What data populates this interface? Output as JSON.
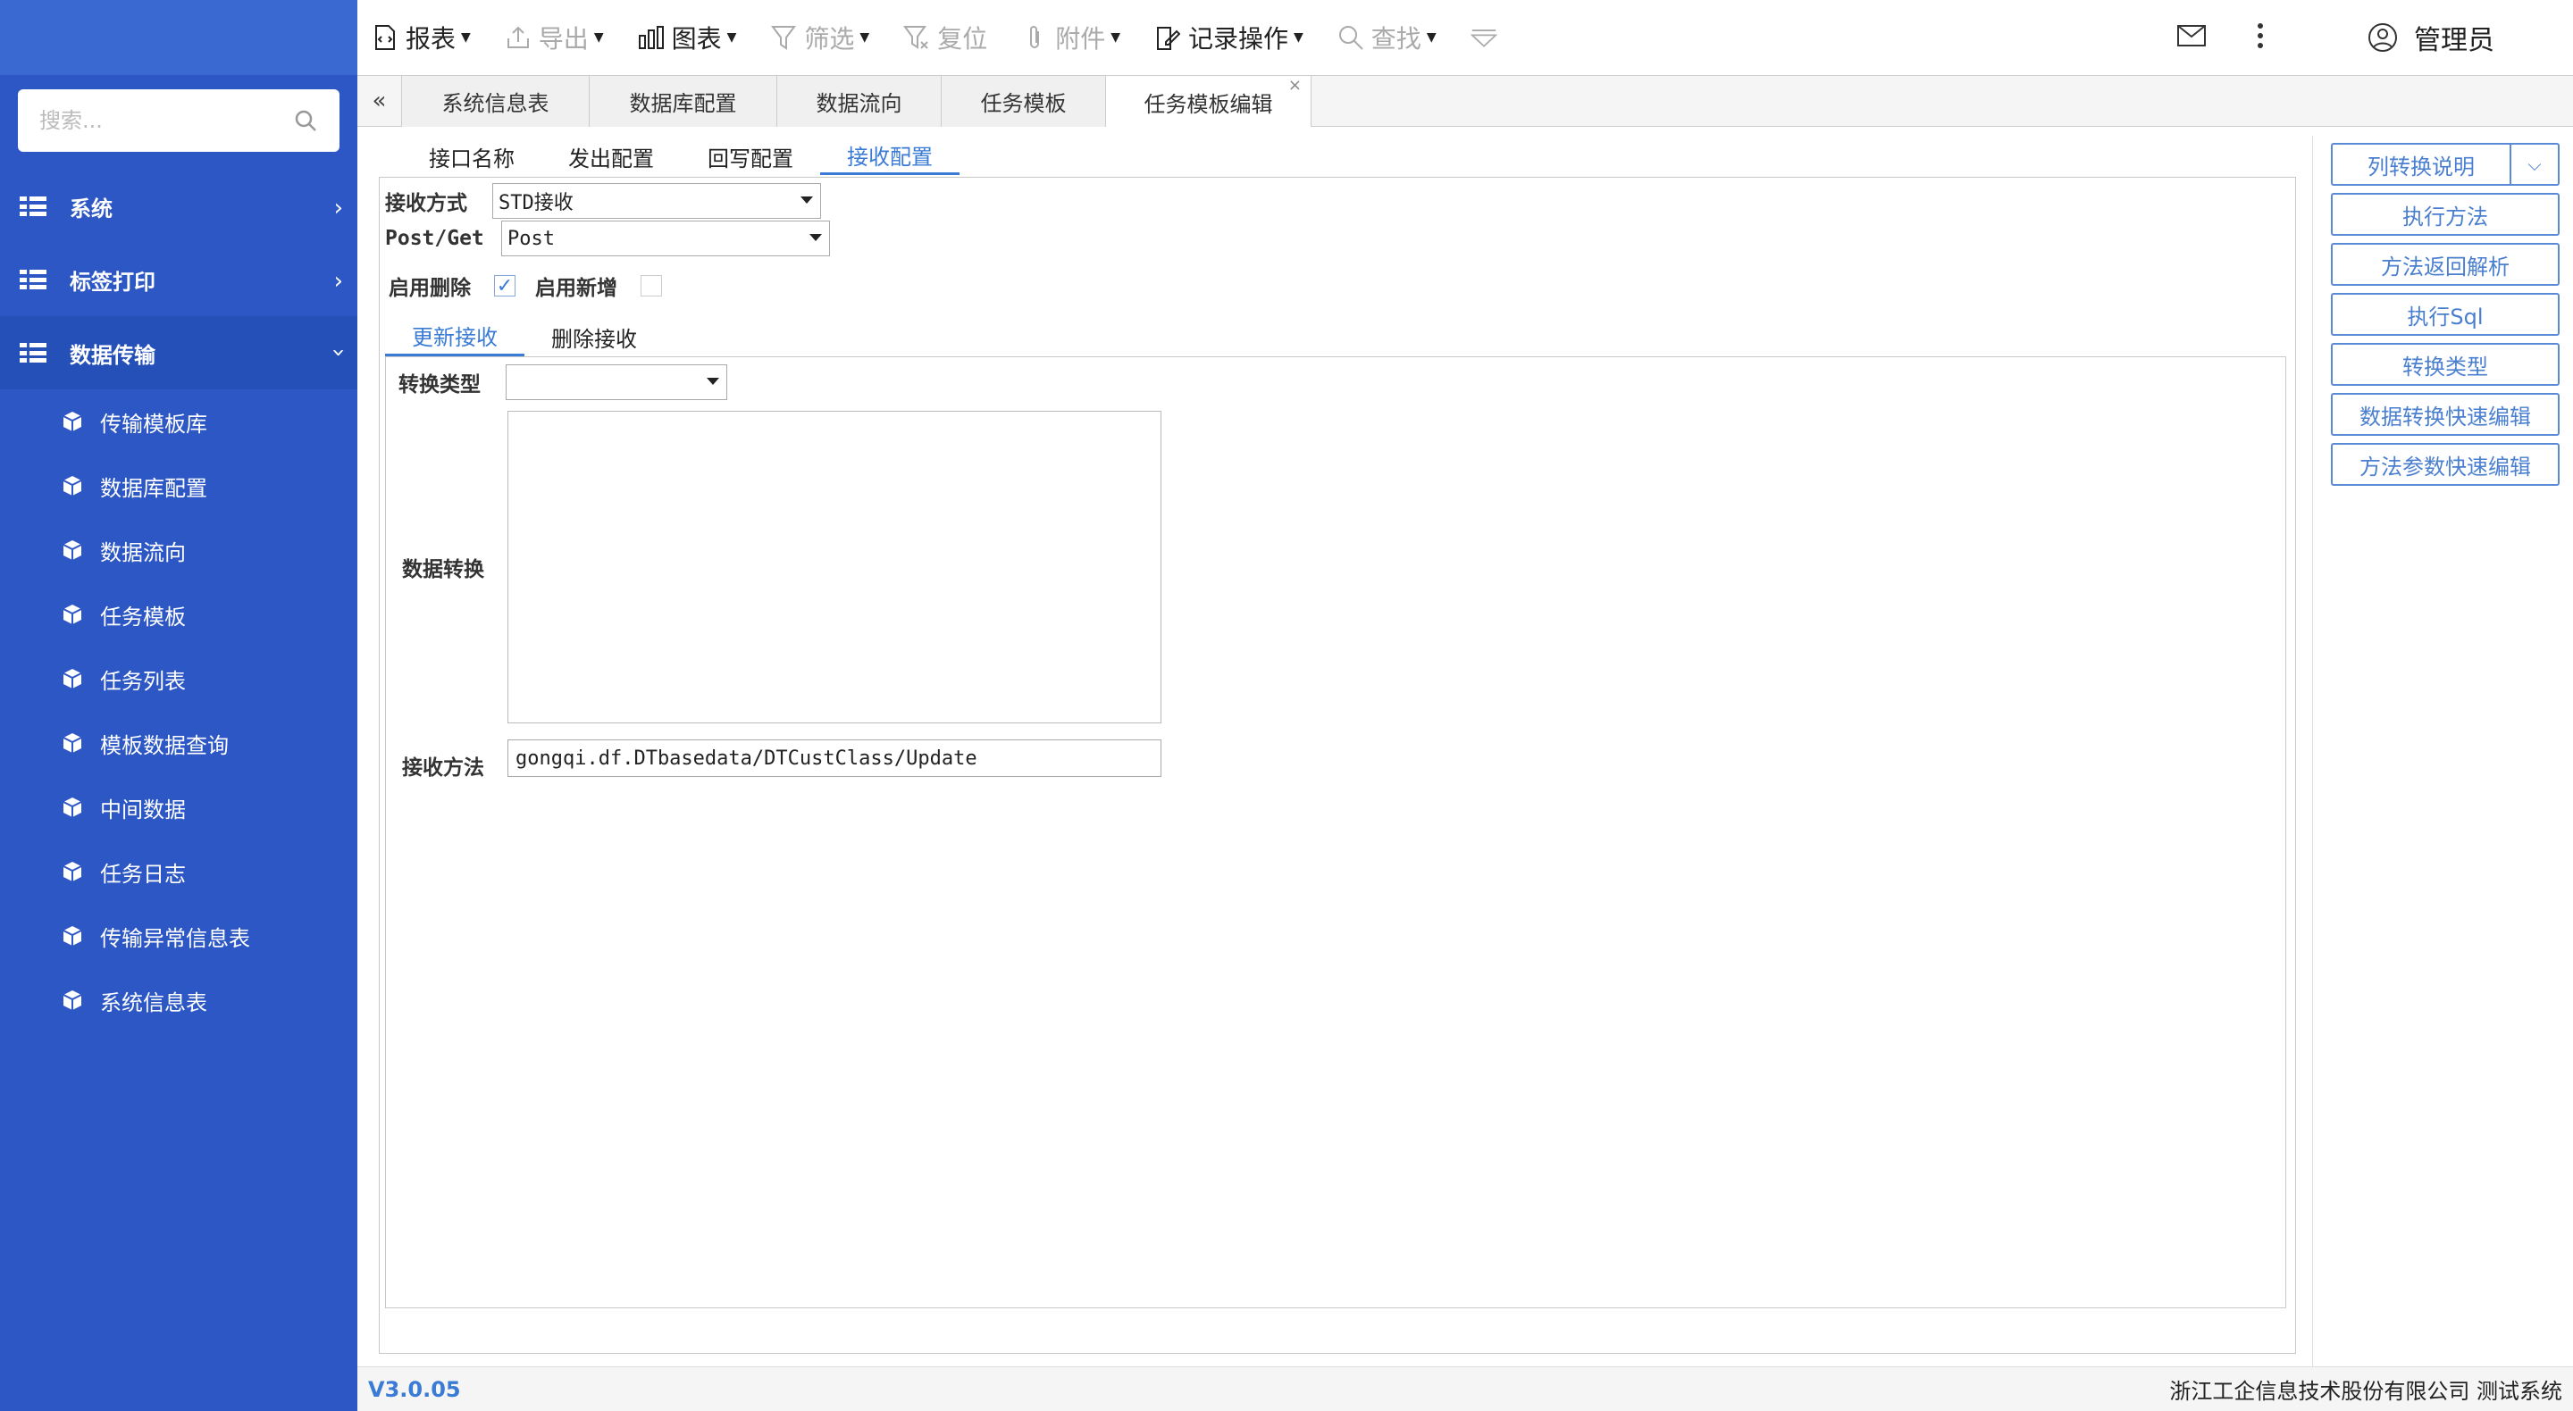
{
  "sidebar": {
    "search_placeholder": "搜索...",
    "groups": [
      {
        "label": "系统"
      },
      {
        "label": "标签打印"
      },
      {
        "label": "数据传输"
      }
    ],
    "items": [
      "传输模板库",
      "数据库配置",
      "数据流向",
      "任务模板",
      "任务列表",
      "模板数据查询",
      "中间数据",
      "任务日志",
      "传输异常信息表",
      "系统信息表"
    ]
  },
  "toolbar": {
    "report": "报表",
    "export": "导出",
    "chart": "图表",
    "filter": "筛选",
    "reset": "复位",
    "attachment": "附件",
    "record_ops": "记录操作",
    "find": "查找",
    "user": "管理员"
  },
  "tabs": [
    "系统信息表",
    "数据库配置",
    "数据流向",
    "任务模板",
    "任务模板编辑"
  ],
  "subtabs": [
    "接口名称",
    "发出配置",
    "回写配置",
    "接收配置"
  ],
  "form": {
    "receive_mode_label": "接收方式",
    "receive_mode_value": "STD接收",
    "method_label": "Post/Get",
    "method_value": "Post",
    "enable_delete_label": "启用删除",
    "enable_add_label": "启用新增",
    "inner_tabs": [
      "更新接收",
      "删除接收"
    ],
    "convert_type_label": "转换类型",
    "convert_type_value": "",
    "data_convert_label": "数据转换",
    "receive_method_label": "接收方法",
    "receive_method_value": "gongqi.df.DTbasedata/DTCustClass/Update"
  },
  "right_buttons": [
    "列转换说明",
    "执行方法",
    "方法返回解析",
    "执行Sql",
    "转换类型",
    "数据转换快速编辑",
    "方法参数快速编辑"
  ],
  "status": {
    "version": "V3.0.05",
    "company": "浙江工企信息技术股份有限公司 测试系统"
  }
}
